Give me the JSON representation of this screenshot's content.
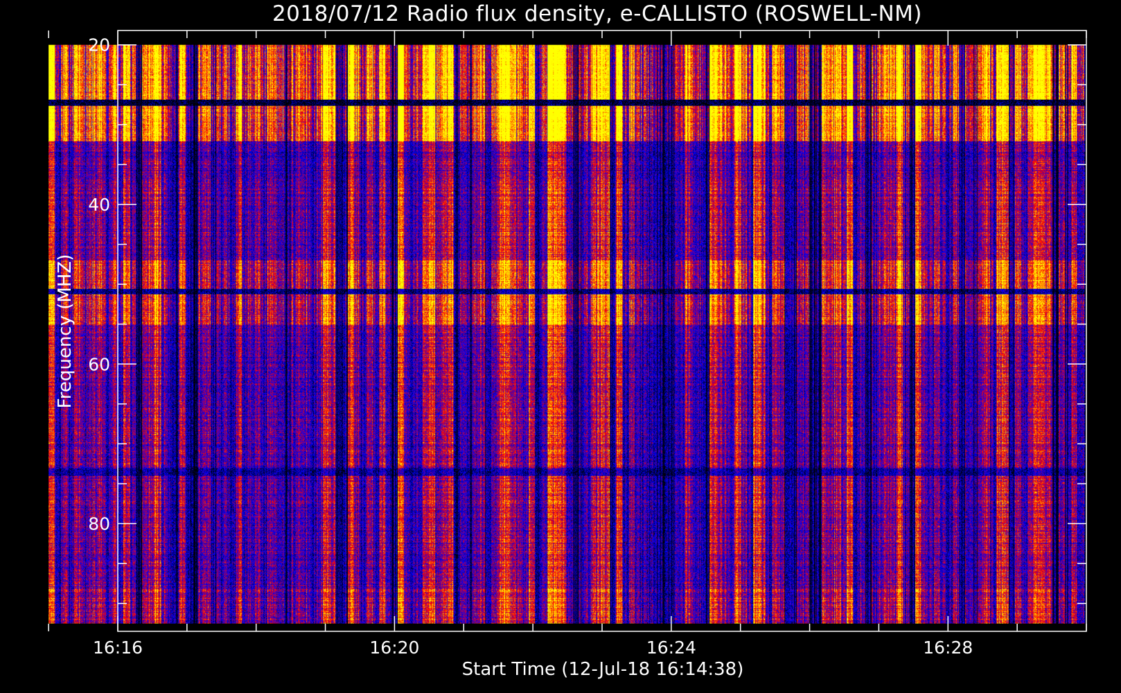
{
  "chart_data": {
    "type": "heatmap",
    "title": "2018/07/12  Radio flux density, e-CALLISTO (ROSWELL-NM)",
    "xlabel": "Start Time (12-Jul-18 16:14:38)",
    "ylabel": "Frequency (MHZ)",
    "x_ticks": [
      "16:16",
      "16:20",
      "16:24",
      "16:28"
    ],
    "y_ticks": [
      20,
      40,
      60,
      80
    ],
    "ylim": [
      93.5,
      18.2
    ],
    "x_range_minutes": [
      16.0,
      30.0
    ],
    "data_extent": {
      "time_start": "16:15",
      "time_end": "16:30",
      "freq_min_mhz": 20,
      "freq_max_mhz": 92.5
    },
    "colormap": [
      "#000000",
      "#0000ff",
      "#ff0000",
      "#ffff00"
    ],
    "grid": false,
    "legend": "none"
  }
}
